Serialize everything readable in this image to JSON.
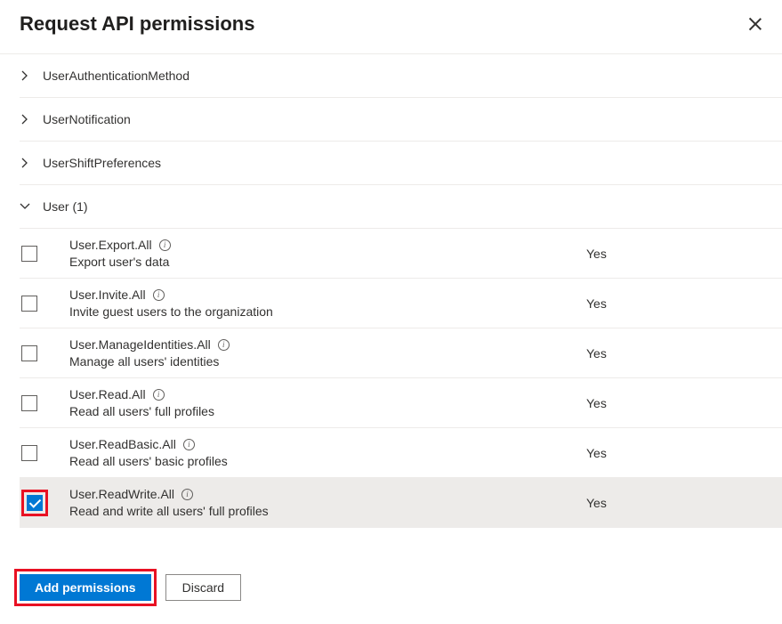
{
  "header": {
    "title": "Request API permissions"
  },
  "groups": [
    {
      "label": "UserAuthenticationMethod",
      "expanded": false
    },
    {
      "label": "UserNotification",
      "expanded": false
    },
    {
      "label": "UserShiftPreferences",
      "expanded": false
    },
    {
      "label": "User (1)",
      "expanded": true
    }
  ],
  "permissions": [
    {
      "name": "User.Export.All",
      "desc": "Export user's data",
      "admin": "Yes",
      "checked": false
    },
    {
      "name": "User.Invite.All",
      "desc": "Invite guest users to the organization",
      "admin": "Yes",
      "checked": false
    },
    {
      "name": "User.ManageIdentities.All",
      "desc": "Manage all users' identities",
      "admin": "Yes",
      "checked": false
    },
    {
      "name": "User.Read.All",
      "desc": "Read all users' full profiles",
      "admin": "Yes",
      "checked": false
    },
    {
      "name": "User.ReadBasic.All",
      "desc": "Read all users' basic profiles",
      "admin": "Yes",
      "checked": false
    },
    {
      "name": "User.ReadWrite.All",
      "desc": "Read and write all users' full profiles",
      "admin": "Yes",
      "checked": true
    }
  ],
  "footer": {
    "add": "Add permissions",
    "discard": "Discard"
  }
}
